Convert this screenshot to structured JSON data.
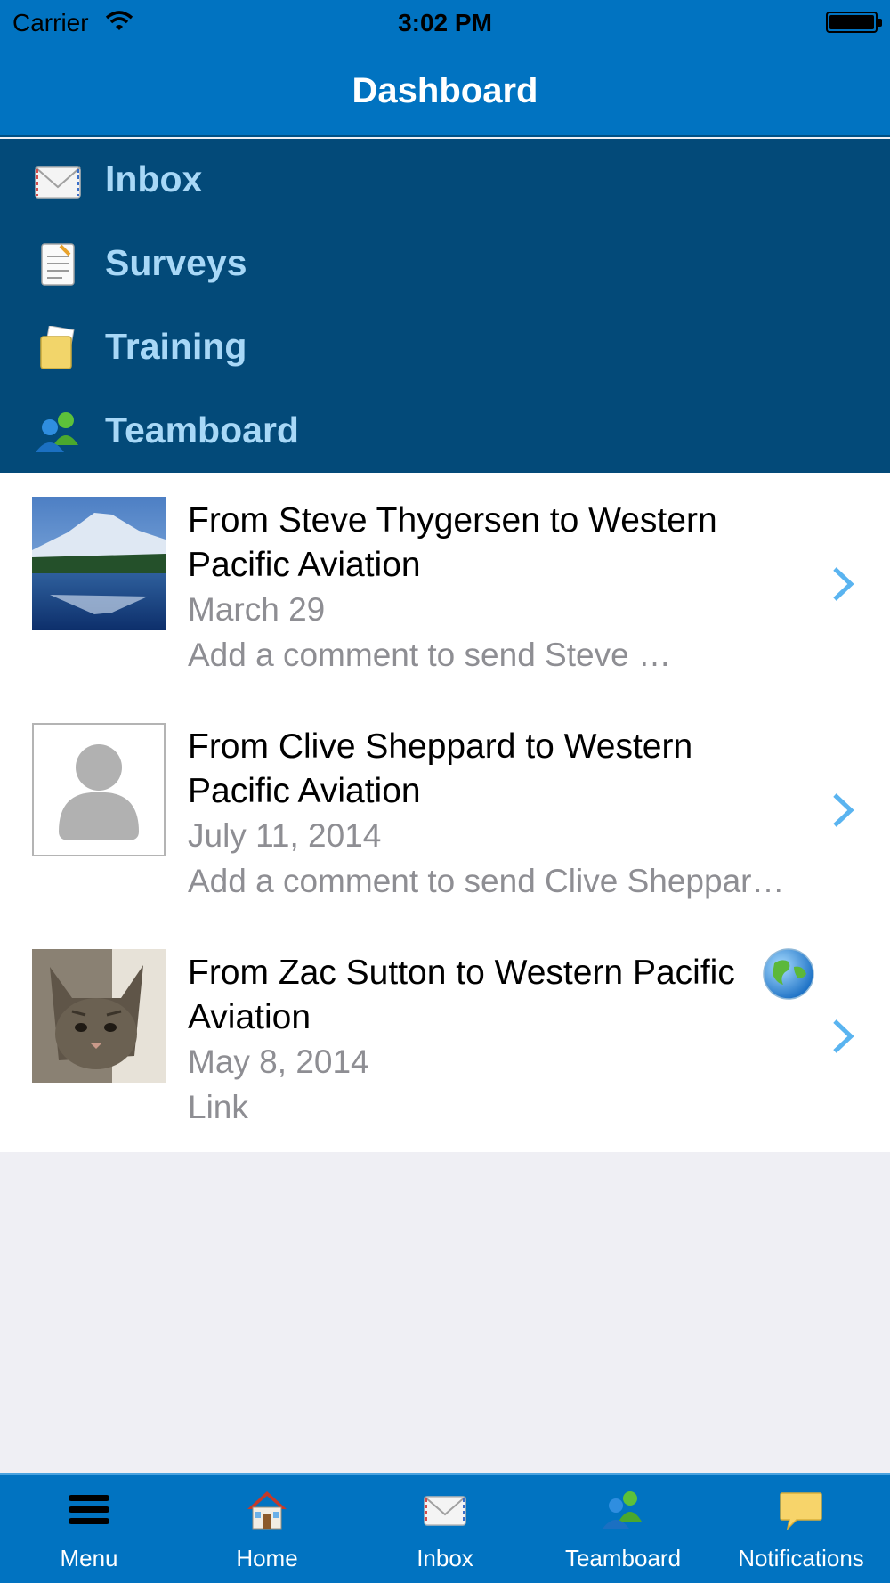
{
  "status_bar": {
    "carrier": "Carrier",
    "time": "3:02 PM"
  },
  "nav": {
    "title": "Dashboard"
  },
  "menu": {
    "items": [
      {
        "label": "Inbox",
        "icon": "envelope-icon"
      },
      {
        "label": "Surveys",
        "icon": "survey-icon"
      },
      {
        "label": "Training",
        "icon": "training-folder-icon"
      },
      {
        "label": "Teamboard",
        "icon": "team-icon"
      }
    ]
  },
  "feed": {
    "items": [
      {
        "title": "From Steve Thygersen to Western Pacific Aviation",
        "date": "March 29",
        "summary": "Add a comment to send Steve …",
        "avatar": "mountain-lake-photo"
      },
      {
        "title": "From Clive Sheppard to Western Pacific Aviation",
        "date": "July 11, 2014",
        "summary": "Add a comment to send Clive Sheppar…",
        "avatar": "default-avatar"
      },
      {
        "title": "From Zac Sutton to Western Pacific Aviation",
        "date": "May 8, 2014",
        "summary": "Link",
        "avatar": "kitten-photo",
        "badge": "globe-icon"
      }
    ]
  },
  "tab_bar": {
    "tabs": [
      {
        "label": "Menu",
        "icon": "hamburger-icon"
      },
      {
        "label": "Home",
        "icon": "house-icon"
      },
      {
        "label": "Inbox",
        "icon": "envelope-icon"
      },
      {
        "label": "Teamboard",
        "icon": "team-icon"
      },
      {
        "label": "Notifications",
        "icon": "speech-bubble-icon"
      }
    ]
  },
  "colors": {
    "primary": "#0173c1",
    "menu_bg": "#034a79",
    "menu_text": "#a8d8f7",
    "chevron": "#5ab4f0",
    "secondary_text": "#8e8e93"
  }
}
